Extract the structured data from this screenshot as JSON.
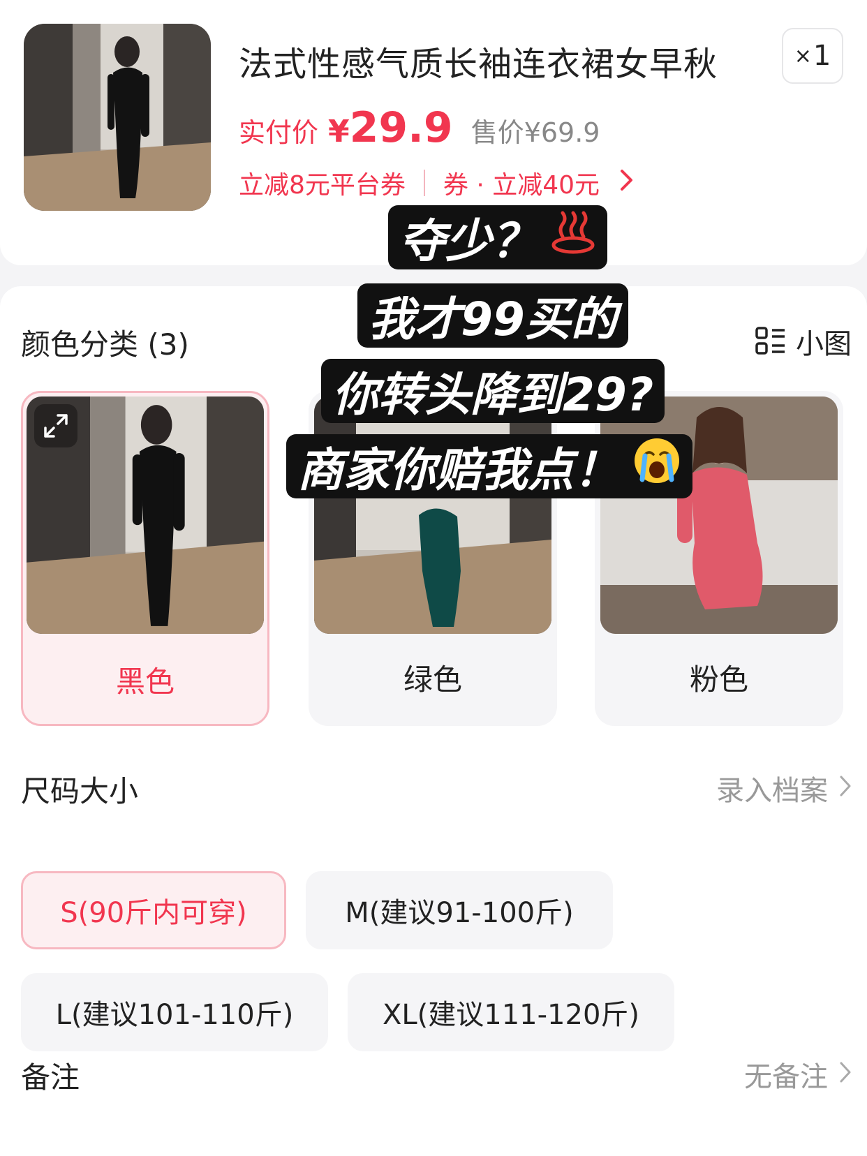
{
  "product": {
    "title": "法式性感气质长袖连衣裙女早秋",
    "quantity_prefix": "×",
    "quantity": "1",
    "price_label": "实付价",
    "price_currency": "¥",
    "price_value": "29.9",
    "original_price": "售价¥69.9",
    "promo_platform": "立减8元平台券",
    "promo_coupon": "券 · 立减40元"
  },
  "colors": {
    "title": "颜色分类 (3)",
    "view_toggle_label": "小图",
    "options": [
      {
        "label": "黑色",
        "selected": true
      },
      {
        "label": "绿色",
        "selected": false
      },
      {
        "label": "粉色",
        "selected": false
      }
    ]
  },
  "sizes": {
    "title": "尺码大小",
    "archive_label": "录入档案",
    "options": [
      {
        "label": "S(90斤内可穿)",
        "selected": true
      },
      {
        "label": "M(建议91-100斤)",
        "selected": false
      },
      {
        "label": "L(建议101-110斤)",
        "selected": false
      },
      {
        "label": "XL(建议111-120斤)",
        "selected": false
      }
    ]
  },
  "note": {
    "title": "备注",
    "value": "无备注"
  },
  "overlay": {
    "line1": "夺少？",
    "line2": "我才99买的",
    "line3": "你转头降到29?",
    "line4": "商家你赔我点！"
  },
  "theme": {
    "accent": "#f1364f",
    "selected_bg": "#fdeff1",
    "selected_border": "#f7b8c1"
  }
}
